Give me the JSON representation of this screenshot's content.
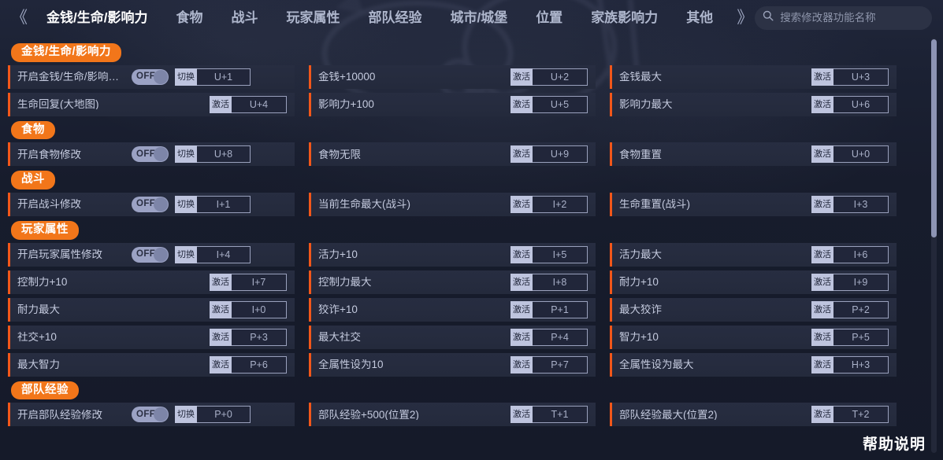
{
  "header": {
    "prev_icon": "chevron-left-double-icon",
    "next_icon": "chevron-right-double-icon",
    "prev_glyph": "《",
    "next_glyph": "》",
    "tabs": [
      {
        "label": "金钱/生命/影响力",
        "active": true
      },
      {
        "label": "食物",
        "active": false
      },
      {
        "label": "战斗",
        "active": false
      },
      {
        "label": "玩家属性",
        "active": false
      },
      {
        "label": "部队经验",
        "active": false
      },
      {
        "label": "城市/城堡",
        "active": false
      },
      {
        "label": "位置",
        "active": false
      },
      {
        "label": "家族影响力",
        "active": false
      },
      {
        "label": "其他",
        "active": false
      }
    ],
    "search": {
      "icon": "search-icon",
      "placeholder": "搜索修改器功能名称",
      "value": ""
    }
  },
  "colors": {
    "accent_orange": "#f2761a",
    "row_bar_orange": "#f2571a",
    "row_bg": "#272d41",
    "page_bg": "#171c2c",
    "chip_text": "#ffffff",
    "label_text": "#c4cade"
  },
  "labels": {
    "toggle_off": "OFF",
    "action_switch": "切换",
    "action_activate": "激活"
  },
  "sections": [
    {
      "title": "金钱/生命/影响力",
      "rows": [
        [
          {
            "label": "开启金钱/生命/影响力...",
            "type": "toggle",
            "toggle": "OFF",
            "action": "切换",
            "key": "U+1"
          },
          {
            "label": "金钱+10000",
            "type": "activate",
            "action": "激活",
            "key": "U+2"
          },
          {
            "label": "金钱最大",
            "type": "activate",
            "action": "激活",
            "key": "U+3"
          }
        ],
        [
          {
            "label": "生命回复(大地图)",
            "type": "activate",
            "action": "激活",
            "key": "U+4"
          },
          {
            "label": "影响力+100",
            "type": "activate",
            "action": "激活",
            "key": "U+5"
          },
          {
            "label": "影响力最大",
            "type": "activate",
            "action": "激活",
            "key": "U+6"
          }
        ]
      ]
    },
    {
      "title": "食物",
      "rows": [
        [
          {
            "label": "开启食物修改",
            "type": "toggle",
            "toggle": "OFF",
            "action": "切换",
            "key": "U+8"
          },
          {
            "label": "食物无限",
            "type": "activate",
            "action": "激活",
            "key": "U+9"
          },
          {
            "label": "食物重置",
            "type": "activate",
            "action": "激活",
            "key": "U+0"
          }
        ]
      ]
    },
    {
      "title": "战斗",
      "rows": [
        [
          {
            "label": "开启战斗修改",
            "type": "toggle",
            "toggle": "OFF",
            "action": "切换",
            "key": "I+1"
          },
          {
            "label": "当前生命最大(战斗)",
            "type": "activate",
            "action": "激活",
            "key": "I+2"
          },
          {
            "label": "生命重置(战斗)",
            "type": "activate",
            "action": "激活",
            "key": "I+3"
          }
        ]
      ]
    },
    {
      "title": "玩家属性",
      "rows": [
        [
          {
            "label": "开启玩家属性修改",
            "type": "toggle",
            "toggle": "OFF",
            "action": "切换",
            "key": "I+4"
          },
          {
            "label": "活力+10",
            "type": "activate",
            "action": "激活",
            "key": "I+5"
          },
          {
            "label": "活力最大",
            "type": "activate",
            "action": "激活",
            "key": "I+6"
          }
        ],
        [
          {
            "label": "控制力+10",
            "type": "activate",
            "action": "激活",
            "key": "I+7"
          },
          {
            "label": "控制力最大",
            "type": "activate",
            "action": "激活",
            "key": "I+8"
          },
          {
            "label": "耐力+10",
            "type": "activate",
            "action": "激活",
            "key": "I+9"
          }
        ],
        [
          {
            "label": "耐力最大",
            "type": "activate",
            "action": "激活",
            "key": "I+0"
          },
          {
            "label": "狡诈+10",
            "type": "activate",
            "action": "激活",
            "key": "P+1"
          },
          {
            "label": "最大狡诈",
            "type": "activate",
            "action": "激活",
            "key": "P+2"
          }
        ],
        [
          {
            "label": "社交+10",
            "type": "activate",
            "action": "激活",
            "key": "P+3"
          },
          {
            "label": "最大社交",
            "type": "activate",
            "action": "激活",
            "key": "P+4"
          },
          {
            "label": "智力+10",
            "type": "activate",
            "action": "激活",
            "key": "P+5"
          }
        ],
        [
          {
            "label": "最大智力",
            "type": "activate",
            "action": "激活",
            "key": "P+6"
          },
          {
            "label": "全属性设为10",
            "type": "activate",
            "action": "激活",
            "key": "P+7"
          },
          {
            "label": "全属性设为最大",
            "type": "activate",
            "action": "激活",
            "key": "H+3"
          }
        ]
      ]
    },
    {
      "title": "部队经验",
      "rows": [
        [
          {
            "label": "开启部队经验修改",
            "type": "toggle",
            "toggle": "OFF",
            "action": "切换",
            "key": "P+0"
          },
          {
            "label": "部队经验+500(位置2)",
            "type": "activate",
            "action": "激活",
            "key": "T+1"
          },
          {
            "label": "部队经验最大(位置2)",
            "type": "activate",
            "action": "激活",
            "key": "T+2"
          }
        ]
      ]
    }
  ],
  "footer": {
    "help_label": "帮助说明"
  },
  "scrollbar": {
    "thumb_top_pct": 0,
    "thumb_height_pct": 47
  }
}
